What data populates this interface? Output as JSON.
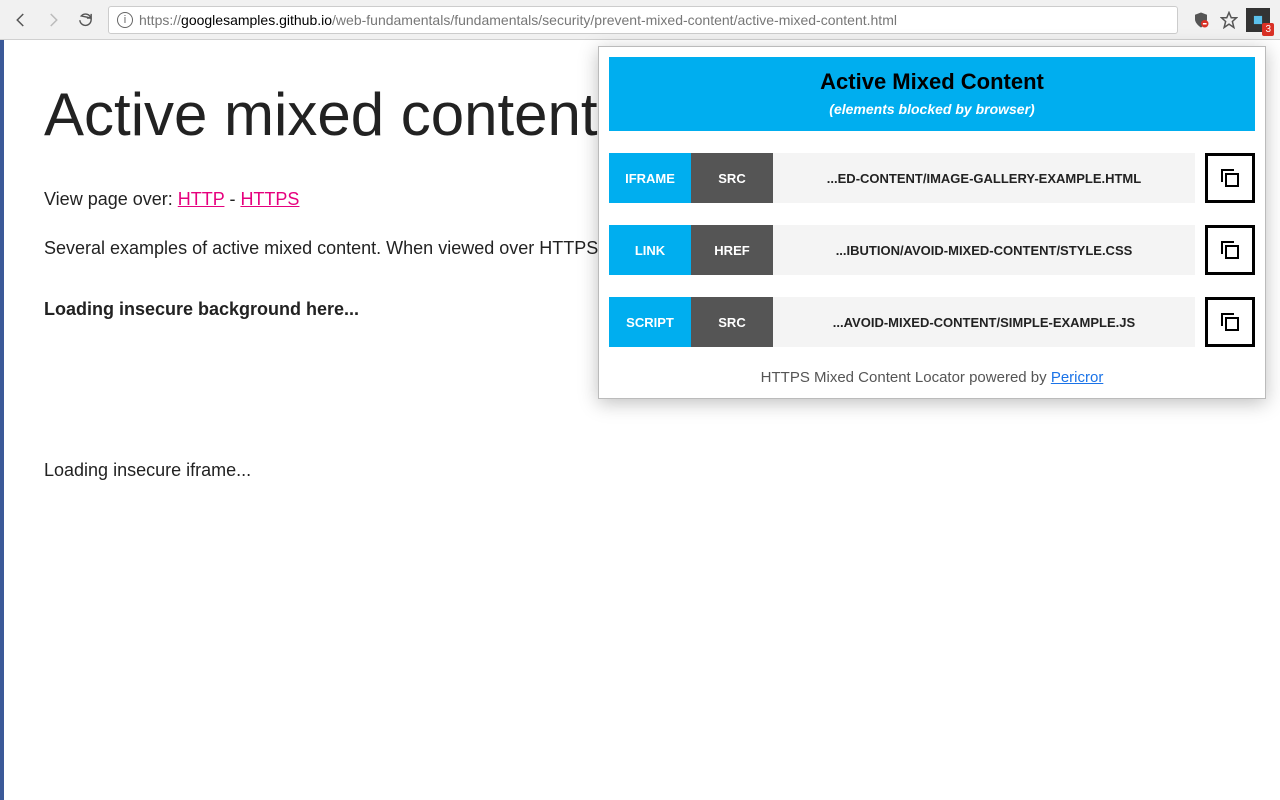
{
  "chrome": {
    "url_dark1": "googlesamples.github.io",
    "url_light1": "https://",
    "url_light2": "/web-fundamentals/fundamentals/security/prevent-mixed-content/active-mixed-content.html",
    "ext_badge": "3"
  },
  "page": {
    "heading": "Active mixed content!",
    "view_label": "View page over: ",
    "http": "HTTP",
    "sep": " - ",
    "https": "HTTPS",
    "desc": "Several examples of active mixed content. When viewed over HTTPS m",
    "bg_text": "Loading insecure background here...",
    "iframe_text": "Loading insecure iframe..."
  },
  "popup": {
    "title": "Active Mixed Content",
    "subtitle": "(elements blocked by browser)",
    "rows": [
      {
        "tag": "IFRAME",
        "attr": "SRC",
        "url": "...ED-CONTENT/IMAGE-GALLERY-EXAMPLE.HTML"
      },
      {
        "tag": "LINK",
        "attr": "HREF",
        "url": "...IBUTION/AVOID-MIXED-CONTENT/STYLE.CSS"
      },
      {
        "tag": "SCRIPT",
        "attr": "SRC",
        "url": "...AVOID-MIXED-CONTENT/SIMPLE-EXAMPLE.JS"
      }
    ],
    "footer_text": "HTTPS Mixed Content Locator powered by ",
    "footer_link": "Pericror"
  }
}
